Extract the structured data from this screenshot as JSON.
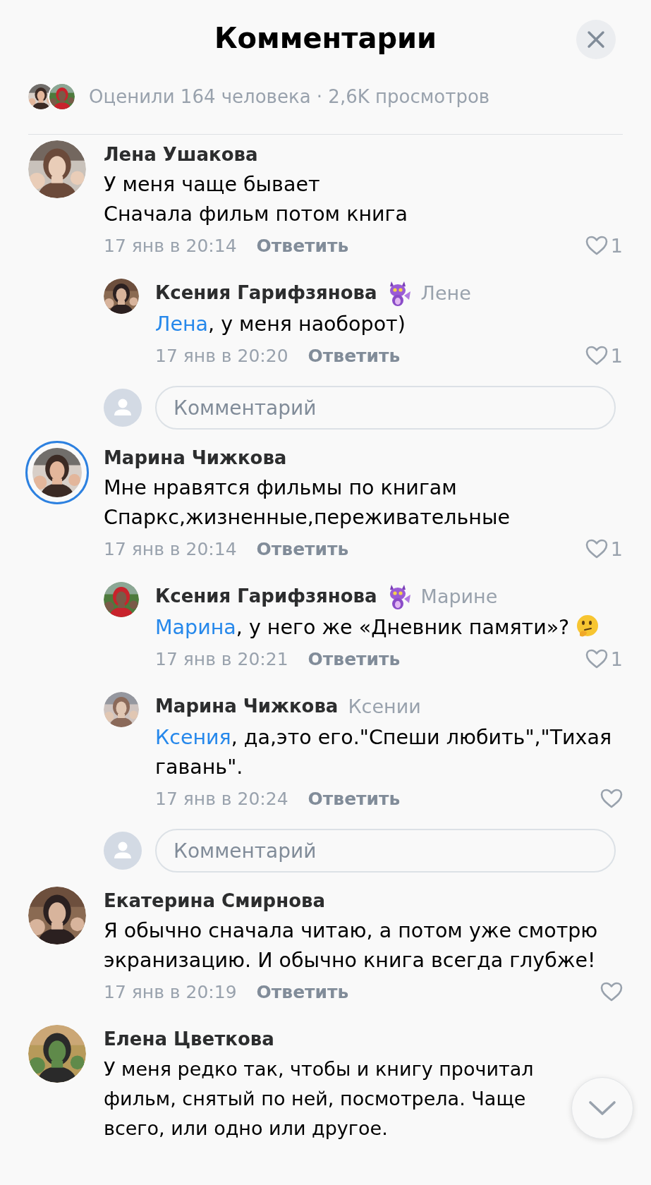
{
  "header": {
    "title": "Комментарии"
  },
  "stats": {
    "text": "Оценили 164 человека · 2,6K просмотров"
  },
  "comments": [
    {
      "kind": "comment",
      "author": "Лена Ушакова",
      "story_ring": false,
      "text": "У меня чаще бывает\nСначала фильм потом книга",
      "date": "17 янв в 20:14",
      "reply_label": "Ответить",
      "likes": "1"
    },
    {
      "kind": "reply",
      "author": "Ксения Гарифзянова",
      "sticker": true,
      "addressee": "Лене",
      "mention": "Лена",
      "text": ", у меня наоборот)",
      "date": "17 янв в 20:20",
      "reply_label": "Ответить",
      "likes": "1"
    },
    {
      "kind": "input",
      "placeholder": "Комментарий"
    },
    {
      "kind": "comment",
      "author": "Марина Чижкова",
      "story_ring": true,
      "text": "Мне нравятся фильмы по книгам\nСпаркс,жизненные,переживательные",
      "date": "17 янв в 20:14",
      "reply_label": "Ответить",
      "likes": "1"
    },
    {
      "kind": "reply",
      "author": "Ксения Гарифзянова",
      "sticker": true,
      "addressee": "Марине",
      "mention": "Марина",
      "text": ", у него же «Дневник памяти»?",
      "thinking_emoji": true,
      "date": "17 янв в 20:21",
      "reply_label": "Ответить",
      "likes": "1"
    },
    {
      "kind": "reply",
      "author": "Марина Чижкова",
      "sticker": false,
      "addressee": "Ксении",
      "mention": "Ксения",
      "text": ", да,это его.\"Спеши любить\",\"Тихая гавань\".",
      "date": "17 янв в 20:24",
      "reply_label": "Ответить"
    },
    {
      "kind": "input",
      "placeholder": "Комментарий"
    },
    {
      "kind": "comment",
      "author": "Екатерина Смирнова",
      "story_ring": false,
      "text": "Я обычно сначала читаю, а потом уже смотрю экранизацию. И обычно книга всегда глубже!",
      "date": "17 янв в 20:19",
      "reply_label": "Ответить"
    },
    {
      "kind": "comment",
      "author": "Елена Цветкова",
      "story_ring": false,
      "text": "У меня редко так, чтобы и  книгу прочитал\nфильм, снятый по ней, посмотрела. Чаще\nвсего, или одно или другое."
    }
  ],
  "scroll_button": {
    "kind": "down"
  }
}
